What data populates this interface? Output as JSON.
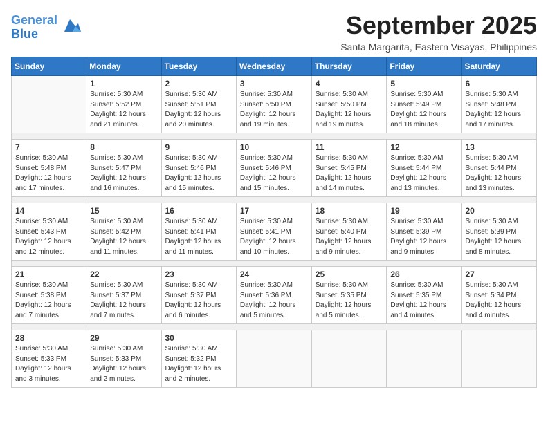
{
  "header": {
    "logo_line1": "General",
    "logo_line2": "Blue",
    "month_title": "September 2025",
    "location": "Santa Margarita, Eastern Visayas, Philippines"
  },
  "calendar": {
    "days_of_week": [
      "Sunday",
      "Monday",
      "Tuesday",
      "Wednesday",
      "Thursday",
      "Friday",
      "Saturday"
    ],
    "weeks": [
      [
        {
          "day": "",
          "info": ""
        },
        {
          "day": "1",
          "info": "Sunrise: 5:30 AM\nSunset: 5:52 PM\nDaylight: 12 hours\nand 21 minutes."
        },
        {
          "day": "2",
          "info": "Sunrise: 5:30 AM\nSunset: 5:51 PM\nDaylight: 12 hours\nand 20 minutes."
        },
        {
          "day": "3",
          "info": "Sunrise: 5:30 AM\nSunset: 5:50 PM\nDaylight: 12 hours\nand 19 minutes."
        },
        {
          "day": "4",
          "info": "Sunrise: 5:30 AM\nSunset: 5:50 PM\nDaylight: 12 hours\nand 19 minutes."
        },
        {
          "day": "5",
          "info": "Sunrise: 5:30 AM\nSunset: 5:49 PM\nDaylight: 12 hours\nand 18 minutes."
        },
        {
          "day": "6",
          "info": "Sunrise: 5:30 AM\nSunset: 5:48 PM\nDaylight: 12 hours\nand 17 minutes."
        }
      ],
      [
        {
          "day": "7",
          "info": "Sunrise: 5:30 AM\nSunset: 5:48 PM\nDaylight: 12 hours\nand 17 minutes."
        },
        {
          "day": "8",
          "info": "Sunrise: 5:30 AM\nSunset: 5:47 PM\nDaylight: 12 hours\nand 16 minutes."
        },
        {
          "day": "9",
          "info": "Sunrise: 5:30 AM\nSunset: 5:46 PM\nDaylight: 12 hours\nand 15 minutes."
        },
        {
          "day": "10",
          "info": "Sunrise: 5:30 AM\nSunset: 5:46 PM\nDaylight: 12 hours\nand 15 minutes."
        },
        {
          "day": "11",
          "info": "Sunrise: 5:30 AM\nSunset: 5:45 PM\nDaylight: 12 hours\nand 14 minutes."
        },
        {
          "day": "12",
          "info": "Sunrise: 5:30 AM\nSunset: 5:44 PM\nDaylight: 12 hours\nand 13 minutes."
        },
        {
          "day": "13",
          "info": "Sunrise: 5:30 AM\nSunset: 5:44 PM\nDaylight: 12 hours\nand 13 minutes."
        }
      ],
      [
        {
          "day": "14",
          "info": "Sunrise: 5:30 AM\nSunset: 5:43 PM\nDaylight: 12 hours\nand 12 minutes."
        },
        {
          "day": "15",
          "info": "Sunrise: 5:30 AM\nSunset: 5:42 PM\nDaylight: 12 hours\nand 11 minutes."
        },
        {
          "day": "16",
          "info": "Sunrise: 5:30 AM\nSunset: 5:41 PM\nDaylight: 12 hours\nand 11 minutes."
        },
        {
          "day": "17",
          "info": "Sunrise: 5:30 AM\nSunset: 5:41 PM\nDaylight: 12 hours\nand 10 minutes."
        },
        {
          "day": "18",
          "info": "Sunrise: 5:30 AM\nSunset: 5:40 PM\nDaylight: 12 hours\nand 9 minutes."
        },
        {
          "day": "19",
          "info": "Sunrise: 5:30 AM\nSunset: 5:39 PM\nDaylight: 12 hours\nand 9 minutes."
        },
        {
          "day": "20",
          "info": "Sunrise: 5:30 AM\nSunset: 5:39 PM\nDaylight: 12 hours\nand 8 minutes."
        }
      ],
      [
        {
          "day": "21",
          "info": "Sunrise: 5:30 AM\nSunset: 5:38 PM\nDaylight: 12 hours\nand 7 minutes."
        },
        {
          "day": "22",
          "info": "Sunrise: 5:30 AM\nSunset: 5:37 PM\nDaylight: 12 hours\nand 7 minutes."
        },
        {
          "day": "23",
          "info": "Sunrise: 5:30 AM\nSunset: 5:37 PM\nDaylight: 12 hours\nand 6 minutes."
        },
        {
          "day": "24",
          "info": "Sunrise: 5:30 AM\nSunset: 5:36 PM\nDaylight: 12 hours\nand 5 minutes."
        },
        {
          "day": "25",
          "info": "Sunrise: 5:30 AM\nSunset: 5:35 PM\nDaylight: 12 hours\nand 5 minutes."
        },
        {
          "day": "26",
          "info": "Sunrise: 5:30 AM\nSunset: 5:35 PM\nDaylight: 12 hours\nand 4 minutes."
        },
        {
          "day": "27",
          "info": "Sunrise: 5:30 AM\nSunset: 5:34 PM\nDaylight: 12 hours\nand 4 minutes."
        }
      ],
      [
        {
          "day": "28",
          "info": "Sunrise: 5:30 AM\nSunset: 5:33 PM\nDaylight: 12 hours\nand 3 minutes."
        },
        {
          "day": "29",
          "info": "Sunrise: 5:30 AM\nSunset: 5:33 PM\nDaylight: 12 hours\nand 2 minutes."
        },
        {
          "day": "30",
          "info": "Sunrise: 5:30 AM\nSunset: 5:32 PM\nDaylight: 12 hours\nand 2 minutes."
        },
        {
          "day": "",
          "info": ""
        },
        {
          "day": "",
          "info": ""
        },
        {
          "day": "",
          "info": ""
        },
        {
          "day": "",
          "info": ""
        }
      ]
    ]
  }
}
